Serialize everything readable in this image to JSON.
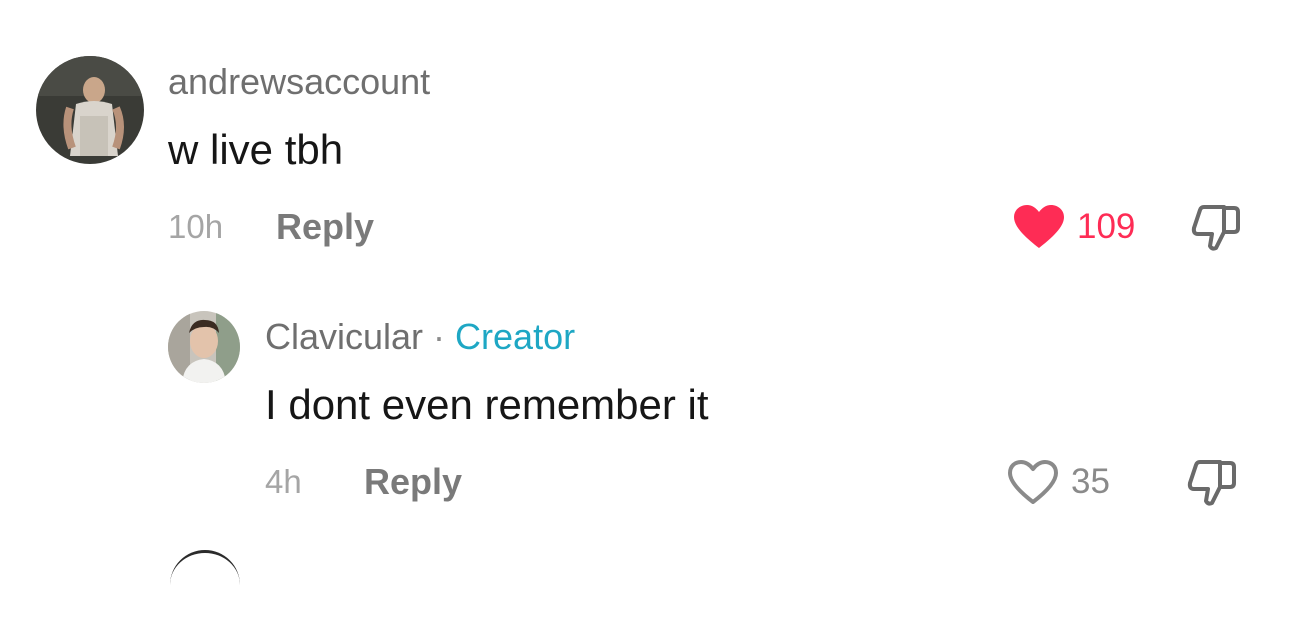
{
  "comments": [
    {
      "username": "andrewsaccount",
      "text": "w live tbh",
      "time": "10h",
      "reply_label": "Reply",
      "like_count": "109",
      "liked": true,
      "like_color": "#fe2c55"
    },
    {
      "username": "Clavicular",
      "separator": "·",
      "badge": "Creator",
      "text": "I dont even remember it",
      "time": "4h",
      "reply_label": "Reply",
      "like_count": "35",
      "liked": false,
      "like_color": "#8a8a8a",
      "badge_color": "#1ea7c4"
    }
  ]
}
